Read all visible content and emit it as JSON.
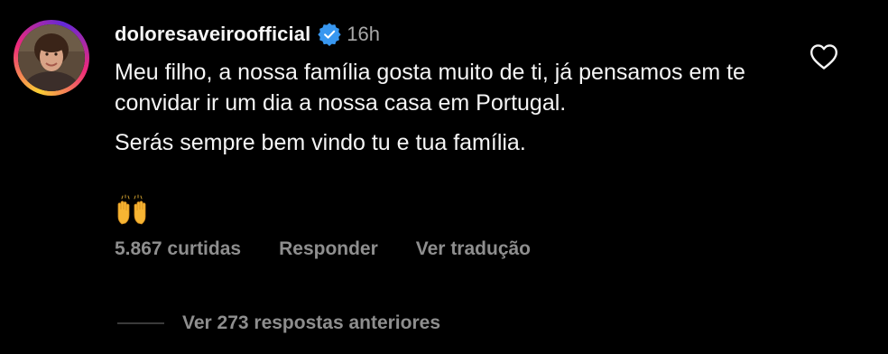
{
  "comment": {
    "avatar_icon": "profile-photo",
    "username": "doloresaveiroofficial",
    "verified_icon": "verified-badge-icon",
    "time": "16h",
    "like_icon": "heart-icon",
    "text_paragraph_1": "Meu filho, a nossa família gosta muito de ti, já pensamos em te convidar ir um dia a nossa casa em Portugal.",
    "text_paragraph_2": "Serás sempre bem vindo tu e tua família.",
    "emoji": "🙌",
    "likes_label": "5.867 curtidas",
    "reply_label": "Responder",
    "translate_label": "Ver tradução",
    "view_replies_label": "Ver 273 respostas anteriores"
  },
  "colors": {
    "background": "#000000",
    "primary_text": "#f5f5f5",
    "secondary_text": "#8e8e8e",
    "verified_blue": "#3897f0"
  }
}
